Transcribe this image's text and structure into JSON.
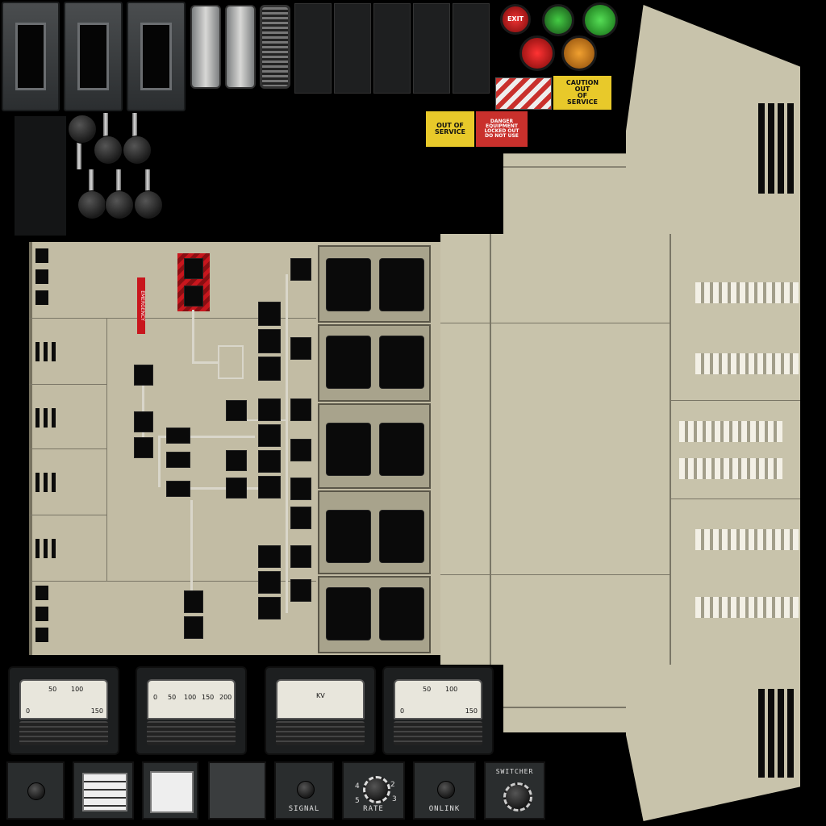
{
  "colors": {
    "beige": "#c8c3ab",
    "black": "#000000",
    "red": "#c8161d",
    "green": "#1b9b2a",
    "orange": "#d9801a",
    "tag_yellow": "#e8c92a",
    "tag_red": "#c9302c"
  },
  "lights": {
    "exit_label": "EXIT"
  },
  "tags": {
    "caution": {
      "header": "CAUTION",
      "line1": "OUT",
      "line2": "OF",
      "line3": "SERVICE"
    },
    "out_of_service": {
      "line1": "OUT OF",
      "line2": "SERVICE"
    },
    "danger": {
      "header": "DANGER",
      "line1": "EQUIPMENT",
      "line2": "LOCKED OUT",
      "line3": "DO NOT USE"
    }
  },
  "panel": {
    "emergency_label": "EMERGENCY"
  },
  "gauges": [
    {
      "ticks": [
        "0",
        "50",
        "100",
        "150"
      ]
    },
    {
      "ticks": [
        "0",
        "50",
        "100",
        "150",
        "200"
      ]
    },
    {
      "ticks": [
        "KV"
      ]
    },
    {
      "ticks": [
        "0",
        "50",
        "100",
        "150"
      ]
    }
  ],
  "controls": {
    "signal": "SIGNAL",
    "rate": "RATE",
    "online": "ONLINK",
    "switcher": "SWITCHER",
    "rate_numbers": [
      "1",
      "2",
      "3",
      "4",
      "5"
    ]
  }
}
